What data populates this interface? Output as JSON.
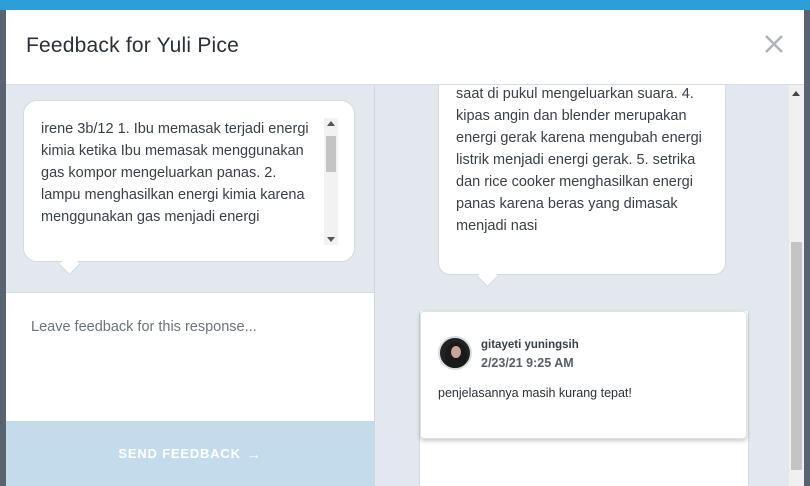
{
  "modal": {
    "title": "Feedback for Yuli Pice",
    "close_icon": "close-icon"
  },
  "response": {
    "text": "irene 3b/12 1. Ibu memasak terjadi energi kimia ketika Ibu memasak menggunakan gas kompor mengeluarkan panas. 2.  lampu menghasilkan energi kimia karena menggunakan gas menjadi energi"
  },
  "feedback": {
    "placeholder": "Leave feedback for this response...",
    "send_label": "SEND FEEDBACK",
    "send_arrow": "→"
  },
  "right_response": {
    "text": "saat di pukul mengeluarkan suara. 4. kipas angin dan blender merupakan energi gerak karena mengubah energi listrik menjadi energi gerak. 5. setrika dan rice cooker menghasilkan energi panas karena beras yang dimasak menjadi nasi"
  },
  "comment": {
    "author": "gitayeti yuningsih",
    "date": "2/23/21 9:25 AM",
    "text": "penjelasannya masih kurang tepat!"
  },
  "colors": {
    "accent_bar": "#2e9ed8",
    "send_button": "#c3dceb",
    "panel_bg": "#e3e8ee"
  }
}
